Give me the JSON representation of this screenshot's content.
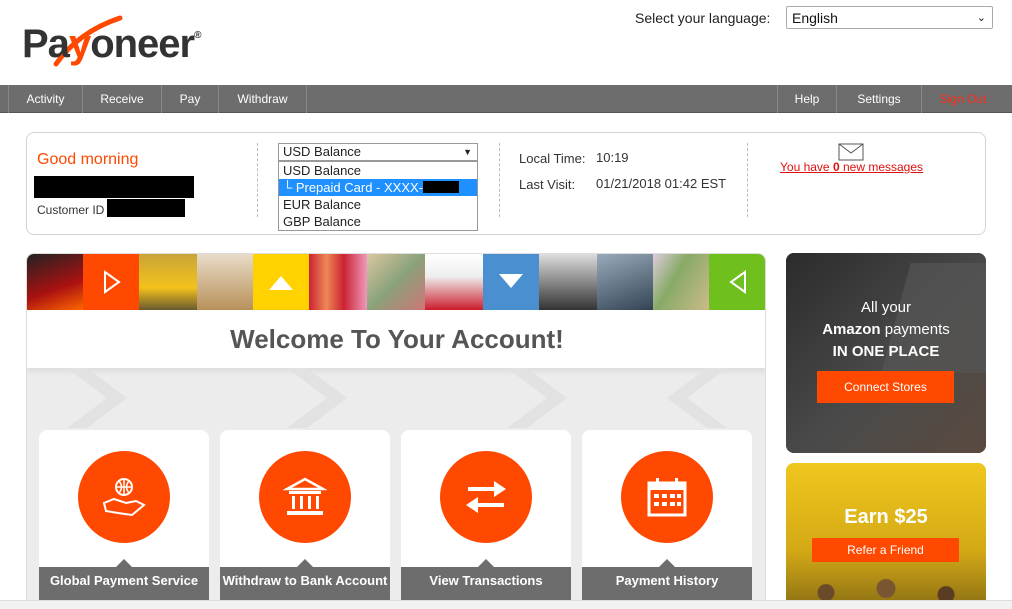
{
  "brand": {
    "logo_text_pre": "Pa",
    "logo_text_y": "y",
    "logo_text_post": "oneer",
    "logo_reg": "®",
    "accent": "#ff4800"
  },
  "language": {
    "label": "Select your language:",
    "selected": "English"
  },
  "nav": {
    "left": [
      "Activity",
      "Receive",
      "Pay",
      "Withdraw"
    ],
    "right": [
      "Help",
      "Settings",
      "Sign Out"
    ]
  },
  "account": {
    "greeting": "Good morning",
    "customer_id_label": "Customer ID",
    "balance_selected": "USD Balance",
    "balance_options": [
      "USD Balance",
      "└ Prepaid Card - XXXX-",
      "EUR Balance",
      "GBP Balance"
    ],
    "local_time_label": "Local Time:",
    "local_time_value": "10:19",
    "last_visit_label": "Last Visit:",
    "last_visit_value": "01/21/2018 01:42 EST",
    "messages_pre": "You have ",
    "messages_count": "0",
    "messages_post": " new messages"
  },
  "main": {
    "welcome": "Welcome To Your Account!",
    "cards": [
      {
        "label": "Global Payment Service",
        "icon": "globe-hand-icon"
      },
      {
        "label": "Withdraw to Bank Account",
        "icon": "bank-icon"
      },
      {
        "label": "View Transactions",
        "icon": "transfer-arrows-icon"
      },
      {
        "label": "Payment History",
        "icon": "calendar-icon"
      }
    ]
  },
  "ads": {
    "amazon": {
      "line1": "All your",
      "line2_bold": "Amazon",
      "line2_rest": " payments",
      "line3": "IN ONE PLACE",
      "button": "Connect Stores"
    },
    "referral": {
      "title": "Earn $25",
      "button": "Refer a Friend"
    }
  }
}
